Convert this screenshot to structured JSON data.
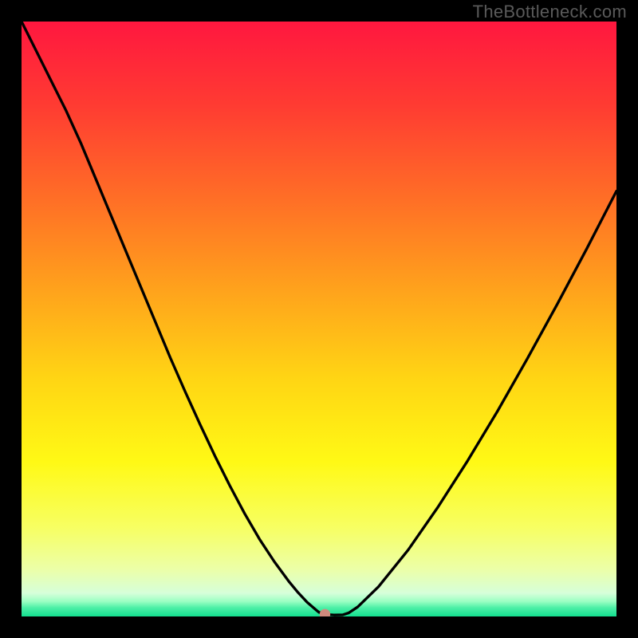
{
  "watermark": "TheBottleneck.com",
  "chart_data": {
    "type": "line",
    "title": "",
    "xlabel": "",
    "ylabel": "",
    "xlim": [
      0,
      100
    ],
    "ylim": [
      0,
      100
    ],
    "background": {
      "type": "vertical_gradient",
      "stops": [
        {
          "pos": 0.0,
          "color": "#ff173f"
        },
        {
          "pos": 0.14,
          "color": "#ff3b32"
        },
        {
          "pos": 0.3,
          "color": "#ff6f26"
        },
        {
          "pos": 0.45,
          "color": "#ffa21c"
        },
        {
          "pos": 0.6,
          "color": "#ffd514"
        },
        {
          "pos": 0.74,
          "color": "#fff915"
        },
        {
          "pos": 0.85,
          "color": "#f7ff62"
        },
        {
          "pos": 0.92,
          "color": "#ecffa7"
        },
        {
          "pos": 0.961,
          "color": "#d6ffda"
        },
        {
          "pos": 0.975,
          "color": "#9affc2"
        },
        {
          "pos": 0.985,
          "color": "#4ff0a7"
        },
        {
          "pos": 1.0,
          "color": "#13df8f"
        }
      ]
    },
    "curve": {
      "x": [
        0.0,
        2.5,
        5.0,
        7.5,
        10.0,
        12.5,
        15.0,
        17.5,
        20.0,
        22.5,
        25.0,
        27.5,
        30.0,
        32.5,
        35.0,
        37.5,
        40.0,
        42.5,
        45.0,
        46.5,
        48.0,
        49.5,
        50.0,
        51.0,
        52.5,
        54.0,
        55.0,
        56.5,
        60.0,
        65.0,
        70.0,
        75.0,
        80.0,
        85.0,
        90.0,
        95.0,
        100.0
      ],
      "y": [
        100.0,
        95.0,
        90.0,
        85.0,
        79.5,
        73.5,
        67.5,
        61.5,
        55.5,
        49.5,
        43.5,
        37.8,
        32.3,
        27.0,
        22.0,
        17.3,
        13.0,
        9.2,
        5.8,
        4.0,
        2.4,
        1.1,
        0.7,
        0.35,
        0.25,
        0.28,
        0.6,
        1.6,
        5.0,
        11.2,
        18.4,
        26.2,
        34.5,
        43.3,
        52.4,
        61.8,
        71.5
      ]
    },
    "marker": {
      "x": 51.0,
      "y": 0.35,
      "color": "#cf8a7d"
    }
  }
}
